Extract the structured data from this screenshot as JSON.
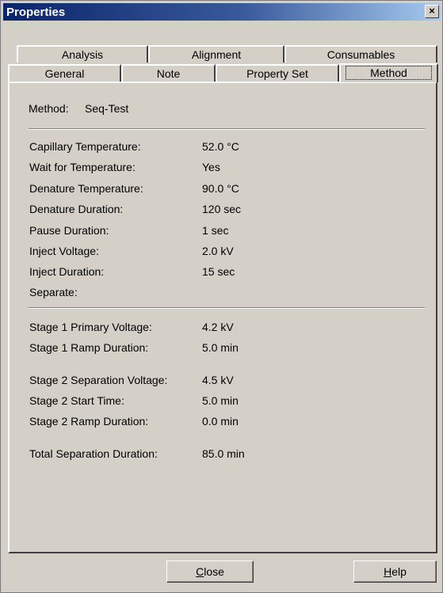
{
  "window": {
    "title": "Properties",
    "close_glyph": "×"
  },
  "tabs_row1": [
    "Analysis",
    "Alignment",
    "Consumables"
  ],
  "tabs_row2": [
    "General",
    "Note",
    "Property Set",
    "Method"
  ],
  "active_tab": "Method",
  "method": {
    "label": "Method:",
    "value": "Seq-Test"
  },
  "params": [
    {
      "label": "Capillary Temperature:",
      "value": "52.0 °C"
    },
    {
      "label": "Wait for Temperature:",
      "value": "Yes"
    },
    {
      "label": "Denature Temperature:",
      "value": "90.0 °C"
    },
    {
      "label": "Denature Duration:",
      "value": "120 sec"
    },
    {
      "label": "Pause Duration:",
      "value": "1 sec"
    },
    {
      "label": "Inject Voltage:",
      "value": "2.0 kV"
    },
    {
      "label": "Inject Duration:",
      "value": "15 sec"
    },
    {
      "label": "Separate:",
      "value": ""
    }
  ],
  "stages": [
    {
      "label": "Stage 1 Primary Voltage:",
      "value": "4.2 kV"
    },
    {
      "label": "Stage 1 Ramp Duration:",
      "value": "5.0 min"
    },
    {
      "label": "Stage 2 Separation Voltage:",
      "value": "4.5 kV"
    },
    {
      "label": "Stage 2 Start Time:",
      "value": "5.0 min"
    },
    {
      "label": "Stage 2 Ramp Duration:",
      "value": "0.0 min"
    },
    {
      "label": "Total Separation Duration:",
      "value": "85.0 min"
    }
  ],
  "buttons": {
    "close_hotkey": "C",
    "close_rest": "lose",
    "help_hotkey": "H",
    "help_rest": "elp"
  }
}
